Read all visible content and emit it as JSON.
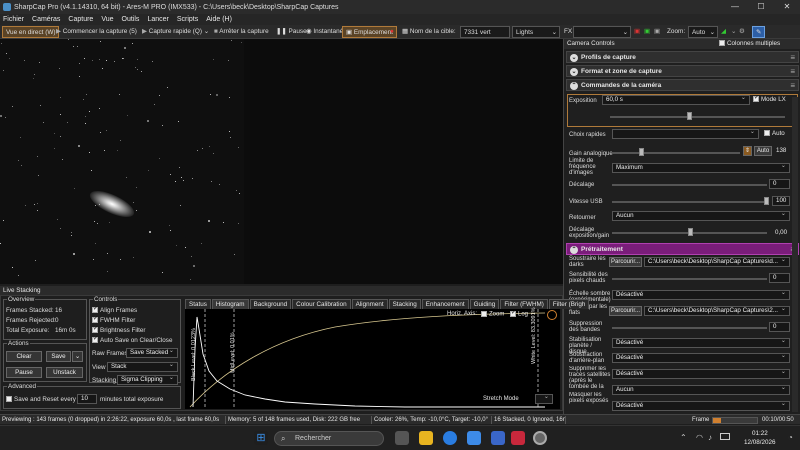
{
  "window": {
    "title": "SharpCap Pro (v4.1.14310, 64 bit) - Ares-M PRO (IMX533) - C:\\Users\\beck\\Desktop\\SharpCap Captures",
    "minimize": "—",
    "maximize": "☐",
    "close": "✕"
  },
  "menu": [
    "Fichier",
    "Caméras",
    "Capture",
    "Vue",
    "Outils",
    "Lancer",
    "Scripts",
    "Aide (H)"
  ],
  "toolbar": {
    "live": "Vue en direct (W)",
    "start_capture": "Commencer la capture (5)",
    "quick_capture": "Capture rapide (Q)",
    "stop_capture": "Arrêter la capture",
    "pause": "Pause",
    "snapshot": "Instantané",
    "placement": "Emplacement",
    "target_label": "Nom de la cible:",
    "target_value": "7331 vert",
    "lights": "Lights",
    "fx": "FX",
    "zoom_label": "Zoom:",
    "zoom_value": "Auto"
  },
  "panel": {
    "title": "Camera Controls",
    "multicol": "Colonnes multiples",
    "profiles": "Profils de capture",
    "format": "Format et zone de capture",
    "camera": "Commandes de la caméra",
    "exposure_label": "Exposition",
    "exposure_value": "60,0 s",
    "lx_label": "Mode LX",
    "quick_label": "Choix rapides",
    "auto_label": "Auto",
    "gain_label": "Gain analogique",
    "gain_auto": "Auto",
    "gain_value": "138",
    "freq_label": "Limite de fréquence d'images",
    "freq_value": "Maximum",
    "offset_label": "Décalage",
    "offset_value": "0",
    "usb_label": "Vitesse USB",
    "usb_value": "100",
    "flip_label": "Retourner",
    "flip_value": "Aucun",
    "expgain_label": "Décalage exposition/gain",
    "expgain_value": "0,00",
    "preproc": "Prétraitement",
    "darks_label": "Soustraire les darks",
    "browse": "Parcourir...",
    "darks_path": "C:\\Users\\beck\\Desktop\\SharpCap Captures\\d...",
    "hotpix_label": "Sensibilité des pixels chauds",
    "hotpix_value": "0",
    "darkscale_label": "Échelle sombre (expérimentale)",
    "darkscale_value": "Désactivé",
    "flats_label": "Diviser par les flats",
    "flats_path": "C:\\Users\\beck\\Desktop\\SharpCap Captures\\2...",
    "bands_label": "Suppression des bandes",
    "bands_value": "0",
    "stab_label": "Stabilisation planète / disque",
    "stab_value": "Désactivé",
    "bg_label": "Soustraction d'arrière-plan",
    "bg_value": "Désactivé",
    "sat_label": "Supprimer les traces satellites (après le tombée de la nuit)",
    "sat_value": "Désactivé",
    "mask_label": "Masquer les pixels exposés",
    "mask_value": "Aucun",
    "last_value": "Désactivé"
  },
  "stacking": {
    "title": "Live Stacking",
    "overview": "Overview",
    "frames_stacked": "Frames Stacked:",
    "frames_stacked_v": "16",
    "frames_rejected": "Frames Rejected:",
    "frames_rejected_v": "0",
    "total_exp": "Total Exposure:",
    "total_exp_v": "16m 0s",
    "actions": "Actions",
    "clear": "Clear",
    "save": "Save",
    "pause": "Pause",
    "unstack": "Unstack",
    "advanced": "Advanced",
    "save_every": "Save and Reset every",
    "save_every_v": "10",
    "save_every_unit": "minutes total exposure",
    "controls": "Controls",
    "align": "Align Frames",
    "fwhm": "FWHM Filter",
    "bright": "Brightness Filter",
    "autosave": "Auto Save on Clear/Close",
    "raw_label": "Raw Frames",
    "raw_value": "Save Stacked",
    "view_label": "View",
    "view_value": "Stack",
    "stacking_label": "Stacking",
    "stacking_value": "Sigma Clipping",
    "tabs": [
      "Status",
      "Histogram",
      "Background",
      "Colour Calibration",
      "Alignment",
      "Stacking",
      "Enhancement",
      "Guiding",
      "Filter (FWHM)",
      "Filter (Brigh"
    ],
    "horiz_axis": "Horiz. Axis:",
    "zoom": "Zoom",
    "log": "Log",
    "stretch": "Stretch Mode",
    "black_level": "Black Level: 0.0123%",
    "mid_level": "MidLevel: 0.01%",
    "white_level": "White Level: 83.3091%"
  },
  "status": {
    "previewing": "Previewing : 143 frames (0 dropped) in 2:26:22, exposure 60,0s , last frame 60,0s",
    "memory": "Memory: 5 of 148 frames used, Disk: 222 GB free",
    "cooler": "Cooler: 26%, Temp: -10,0°C, Target: -10,0°",
    "stacked": "16 Stacked, 0 Ignored, 16m 0s",
    "frame_label": "Frame",
    "frame_time": "00:10/00:50"
  },
  "taskbar": {
    "search": "Rechercher",
    "time": "01:22",
    "date": "12/08/2026"
  }
}
